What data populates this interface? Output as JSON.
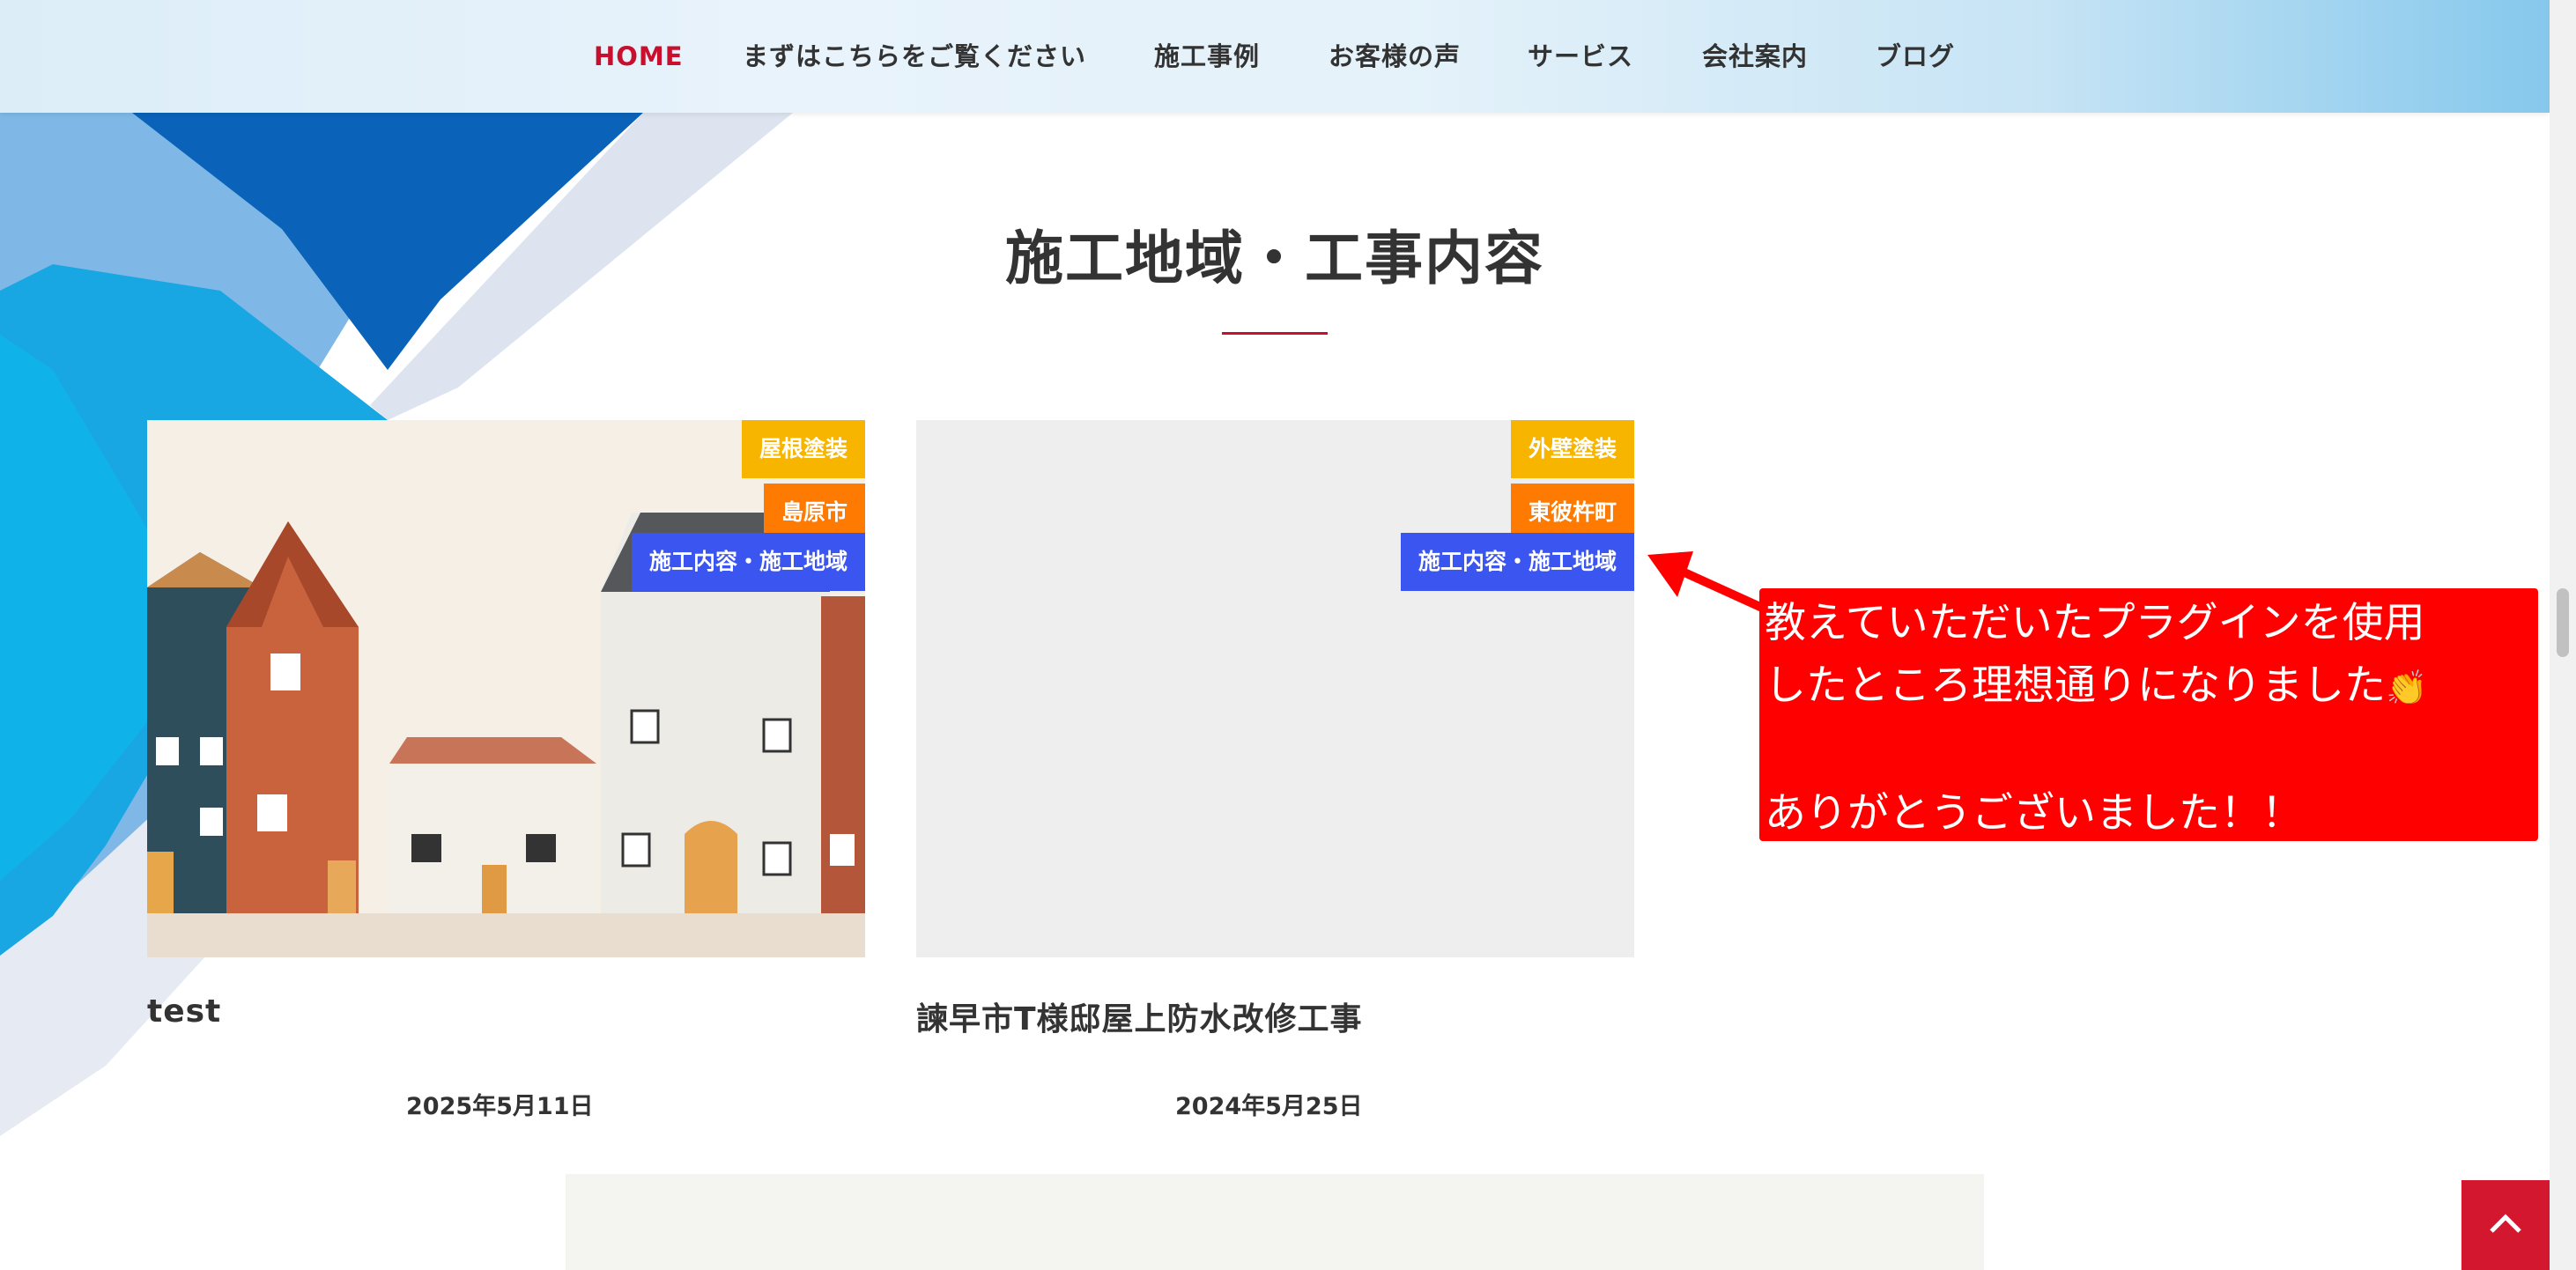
{
  "nav": {
    "items": [
      {
        "label": "HOME",
        "active": true
      },
      {
        "label": "まずはこちらをご覧ください"
      },
      {
        "label": "施工事例"
      },
      {
        "label": "お客様の声"
      },
      {
        "label": "サービス"
      },
      {
        "label": "会社案内"
      },
      {
        "label": "ブログ"
      }
    ]
  },
  "section": {
    "title": "施工地域・工事内容"
  },
  "cards": [
    {
      "tags": [
        "屋根塗装",
        "島原市",
        "施工内容・施工地域"
      ],
      "title": "test",
      "date": "2025年5月11日",
      "thumbnail": "toy-houses-photo"
    },
    {
      "tags": [
        "外壁塗装",
        "東彼杵町",
        "施工内容・施工地域"
      ],
      "title": "諫早市T様邸屋上防水改修工事",
      "date": "2024年5月25日",
      "thumbnail": "empty-placeholder"
    }
  ],
  "annotation": {
    "line1": "教えていただいたプラグインを使用",
    "line2": "したところ理想通りになりました",
    "line2_icon": "clapping-hands-icon",
    "line3": "ありがとうございました！！"
  },
  "back_to_top": {
    "icon": "chevron-up-icon"
  },
  "colors": {
    "accent_red": "#c8102e",
    "tag_yellow": "#f7b500",
    "tag_orange": "#ff7a00",
    "tag_blue": "#3a55f0",
    "annotation_red": "#ff0000"
  }
}
